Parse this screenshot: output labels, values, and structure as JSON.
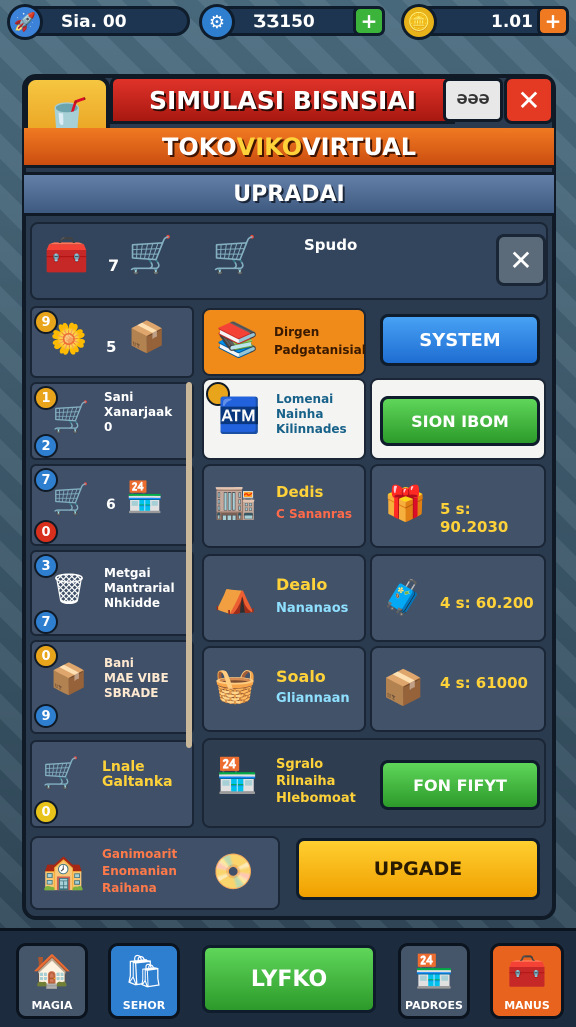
{
  "resources": [
    {
      "icon": "rocket-icon",
      "value": "Sia. 00",
      "color": "#3b82d8"
    },
    {
      "icon": "coin-icon",
      "value": "ƷƷ150",
      "color": "#2f7fd1"
    },
    {
      "icon": "gold-coin-icon",
      "value": "1.01",
      "color": "#e8b21a"
    }
  ],
  "header": {
    "title": "SIMULASI BISNSIAI",
    "level": "ƏƏƏ",
    "subtitle_part1": "TOKO ",
    "subtitle_part2": "VIKO",
    "subtitle_part3": " VIRTUAL",
    "section": "UPRADAI"
  },
  "tools": {
    "count": "7",
    "label": "Spudo"
  },
  "left_list": [
    {
      "badge": "9",
      "num": "5",
      "text": ""
    },
    {
      "badge": "1",
      "badge2": "2",
      "text": "Sani\nXanarjaak\n0"
    },
    {
      "badge": "7",
      "badge2": "0",
      "text": "6"
    },
    {
      "badge": "3",
      "badge2": "7",
      "text": "Metgai\nMantrarial\nNhkidde"
    },
    {
      "badge": "0",
      "badge2": "9",
      "text": "Bani\nMAE VIBE\nSBRADE"
    },
    {
      "badge": "0",
      "text": "Lnale\nGaltanka"
    }
  ],
  "cards": [
    {
      "title": "Dirgen",
      "sub": "Padgatanisial"
    },
    {
      "title": "Lomenai\nNainha\nKilinnades"
    },
    {
      "title": "Dedis",
      "sub": "C Sananras",
      "price": "5 s: 90.2030"
    },
    {
      "title": "Dealo",
      "sub": "Nananaos",
      "price": "4 s: 60.200"
    },
    {
      "title": "Soalo",
      "sub": "Gliannaan",
      "price": "4 s: 61000"
    },
    {
      "title": "Sgralo\nRilnaiha\nHlebomoat"
    },
    {
      "title": "Ganimoarit\nEnomanian\nRaihana"
    }
  ],
  "buttons": {
    "system": "SYSTEM",
    "sion": "SION IBOM",
    "fon": "FON FIFYT",
    "upgrade": "UPGADE",
    "play": "LYFKO"
  },
  "nav": [
    {
      "label": "MAGIA",
      "icon": "home-icon"
    },
    {
      "label": "SEHOR",
      "icon": "bag-icon"
    },
    {
      "label": "PADROES",
      "icon": "shop-icon"
    },
    {
      "label": "MANUS",
      "icon": "chest-icon"
    }
  ]
}
